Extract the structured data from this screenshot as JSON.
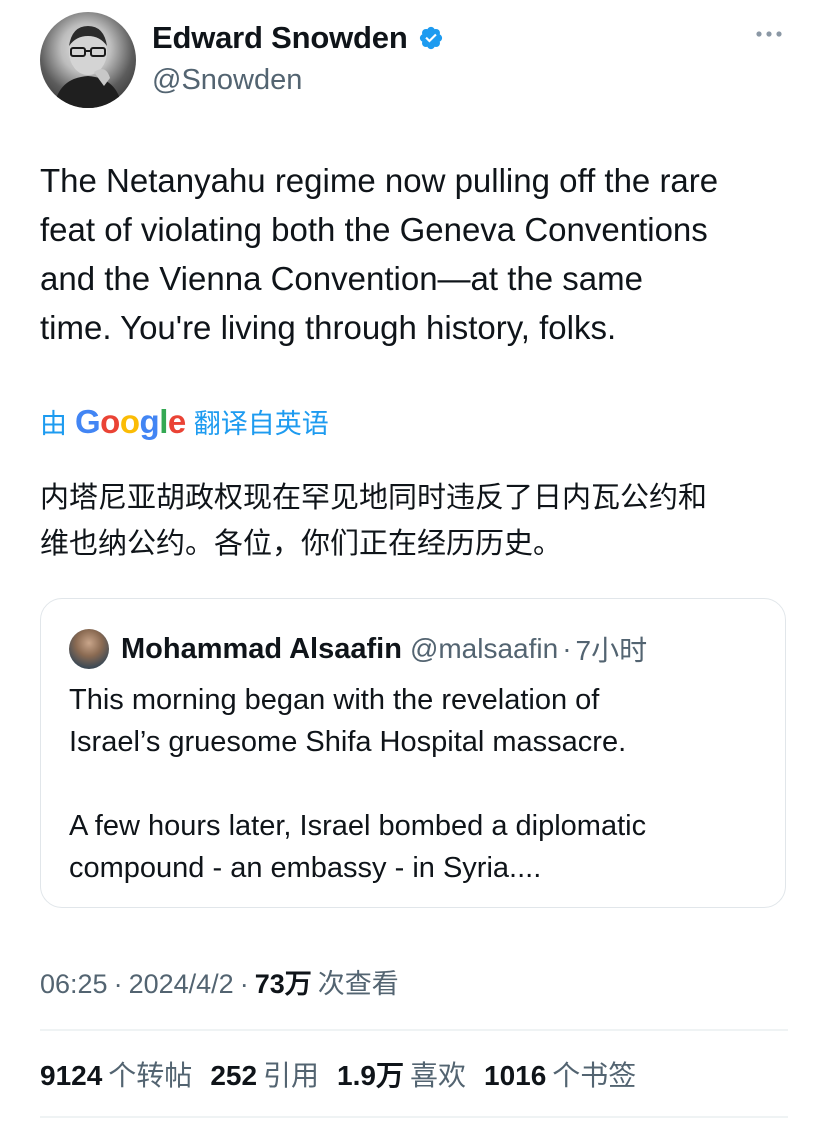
{
  "author": {
    "name": "Edward Snowden",
    "handle": "@Snowden",
    "verified": true
  },
  "tweet": {
    "text": "The Netanyahu regime now pulling off the rare\nfeat of violating both the Geneva Conventions\nand the Vienna Convention—at the same\ntime. You're living through history, folks.",
    "translation": {
      "prefix": "由",
      "provider": "Google",
      "suffix": "翻译自英语",
      "text": "内塔尼亚胡政权现在罕见地同时违反了日内瓦公约和\n维也纳公约。各位，你们正在经历历史。"
    }
  },
  "quoted_tweet": {
    "name": "Mohammad Alsaafin",
    "handle": "@malsaafin",
    "separator": "·",
    "time": "7小时",
    "text": "This morning began with the revelation of\nIsrael’s gruesome Shifa Hospital massacre.\n\nA few hours later, Israel bombed a diplomatic\ncompound - an embassy - in Syria...."
  },
  "meta": {
    "time": "06:25",
    "separator": "·",
    "date": "2024/4/2",
    "views": "73万",
    "views_label": "次查看"
  },
  "stats": {
    "retweets": {
      "count": "9124",
      "label": "个转帖"
    },
    "quotes": {
      "count": "252",
      "label": "引用"
    },
    "likes": {
      "count": "1.9万",
      "label": "喜欢"
    },
    "bookmarks": {
      "count": "1016",
      "label": "个书签"
    }
  },
  "icons": {
    "verified": "verified-badge-icon",
    "more": "more-horizontal-icon"
  },
  "colors": {
    "text_primary": "#0f1419",
    "text_secondary": "#536471",
    "accent": "#1d9bf0",
    "border": "#e1e6ea"
  }
}
